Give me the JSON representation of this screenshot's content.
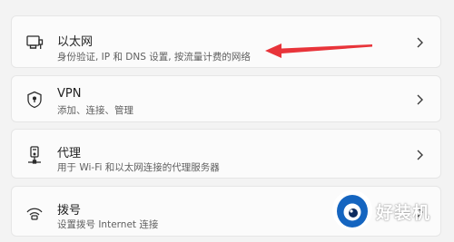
{
  "items": [
    {
      "title": "以太网",
      "description": "身份验证, IP 和 DNS 设置, 按流量计费的网络",
      "icon": "ethernet-icon"
    },
    {
      "title": "VPN",
      "description": "添加、连接、管理",
      "icon": "shield-icon"
    },
    {
      "title": "代理",
      "description": "用于 Wi-Fi 和以太网连接的代理服务器",
      "icon": "proxy-icon"
    },
    {
      "title": "拨号",
      "description": "设置拨号 Internet 连接",
      "icon": "dialup-icon"
    }
  ],
  "colors": {
    "background": "#f3f3f3",
    "card": "#fbfbfb",
    "annotation_arrow": "#e8343a",
    "watermark_blue": "#1565c0"
  },
  "watermark": {
    "text": "好装机"
  }
}
